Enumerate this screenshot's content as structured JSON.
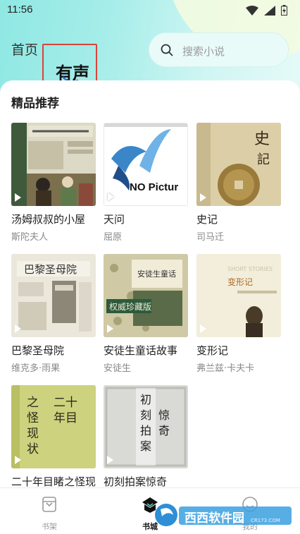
{
  "status_bar": {
    "time": "11:56"
  },
  "header": {
    "tabs": [
      {
        "label": "首页",
        "active": false
      },
      {
        "label": "有声",
        "active": true
      }
    ],
    "search": {
      "placeholder": "搜索小说"
    }
  },
  "section": {
    "title": "精品推荐"
  },
  "books": [
    {
      "title": "汤姆叔叔的小屋",
      "author": "斯陀夫人"
    },
    {
      "title": "天问",
      "author": "屈原",
      "cover_text": "NO Pictur"
    },
    {
      "title": "史记",
      "author": "司马迁"
    },
    {
      "title": "巴黎圣母院",
      "author": "维克多·雨果"
    },
    {
      "title": "安徒生童话故事",
      "author": "安徒生"
    },
    {
      "title": "变形记",
      "author": "弗兰兹·卡夫卡"
    },
    {
      "title": "二十年目睹之怪现状",
      "author": ""
    },
    {
      "title": "初刻拍案惊奇",
      "author": ""
    }
  ],
  "bottom_nav": [
    {
      "label": "书架",
      "icon": "bookshelf-icon",
      "active": false
    },
    {
      "label": "书城",
      "icon": "bookstore-icon",
      "active": true
    },
    {
      "label": "我的",
      "icon": "profile-icon",
      "active": false
    }
  ],
  "watermark": {
    "text": "西西软件园",
    "sub": "CR173.COM"
  },
  "colors": {
    "accent": "#d8443a",
    "header_bg": "#a6ede9",
    "active_nav": "#111111",
    "inactive_nav": "#999999"
  }
}
